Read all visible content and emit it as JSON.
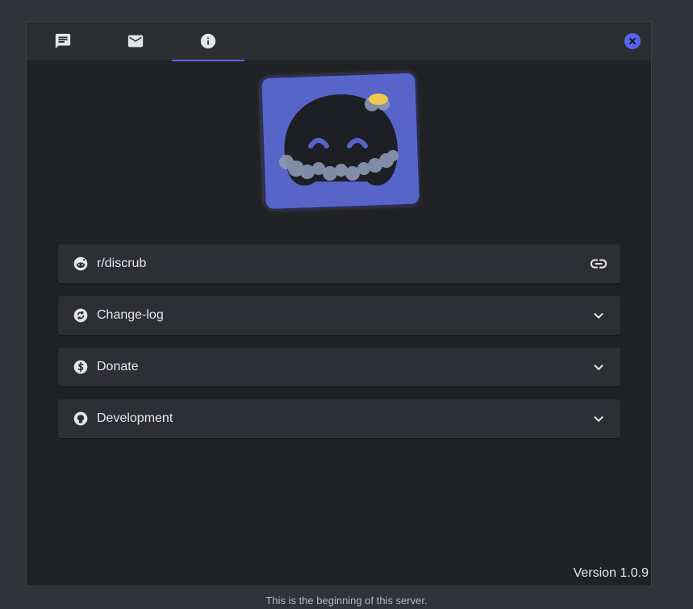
{
  "tabs": [
    {
      "name": "messages",
      "icon": "chat-icon",
      "active": false
    },
    {
      "name": "dms",
      "icon": "mail-icon",
      "active": false
    },
    {
      "name": "info",
      "icon": "info-icon",
      "active": true
    }
  ],
  "close_icon": "close-icon",
  "accent_color": "#5865f2",
  "logo": {
    "icon": "discrub-logo"
  },
  "rows": [
    {
      "label": "r/discrub",
      "icon": "reddit-icon",
      "trail_icon": "link-icon"
    },
    {
      "label": "Change-log",
      "icon": "sync-icon",
      "trail_icon": "chevron-down-icon"
    },
    {
      "label": "Donate",
      "icon": "dollar-icon",
      "trail_icon": "chevron-down-icon"
    },
    {
      "label": "Development",
      "icon": "github-icon",
      "trail_icon": "chevron-down-icon"
    }
  ],
  "version": "Version 1.0.9",
  "footer": "This is the beginning of this server."
}
